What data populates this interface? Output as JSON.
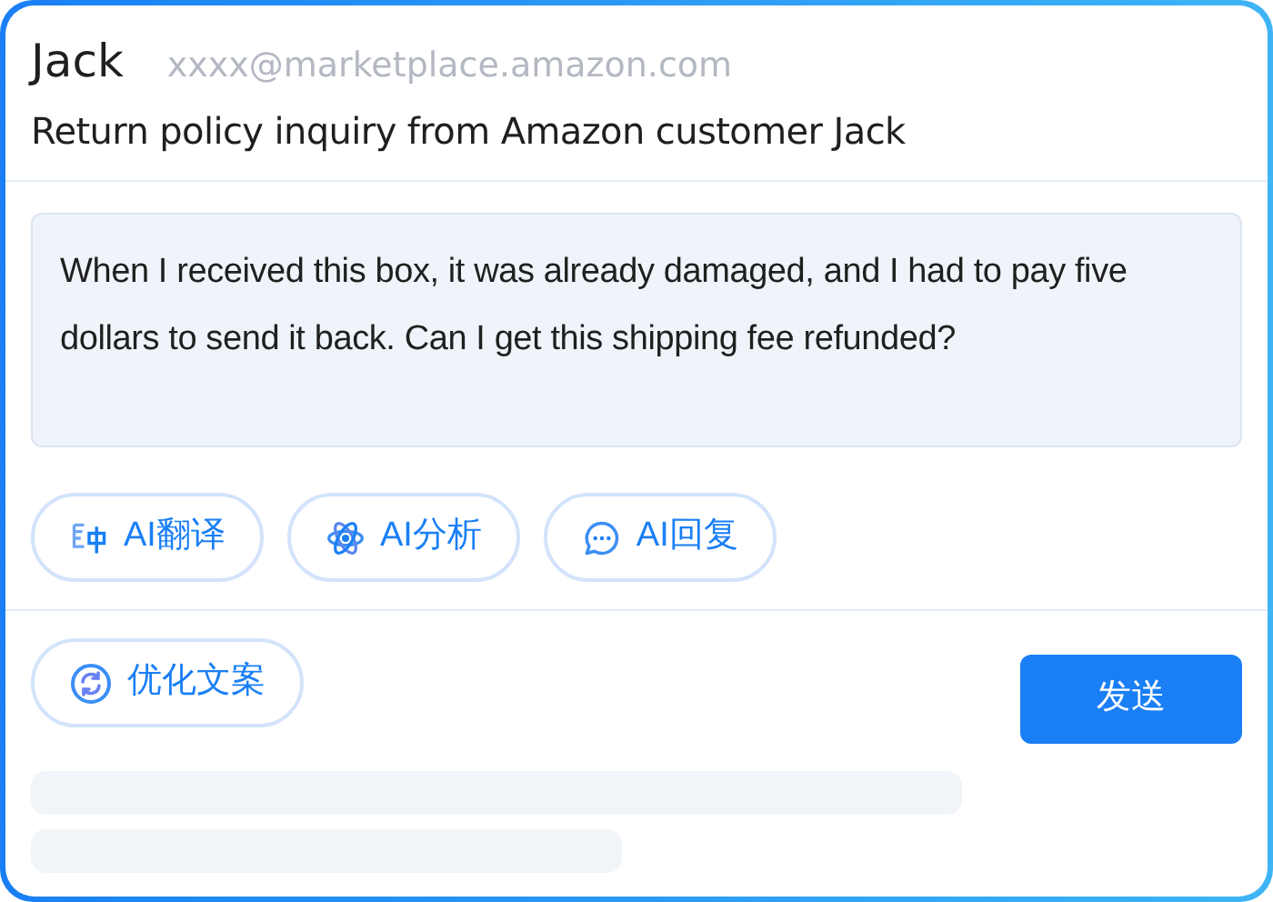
{
  "header": {
    "sender": "Jack",
    "email": "xxxx@marketplace.amazon.com",
    "subject": "Return policy inquiry from Amazon customer Jack"
  },
  "message": "When I received this box, it was already damaged, and I had to pay five dollars to send it back. Can I get this shipping fee refunded?",
  "ai_actions": [
    {
      "kind": "translate",
      "label": "AI翻译"
    },
    {
      "kind": "analyze",
      "label": "AI分析"
    },
    {
      "kind": "reply",
      "label": "AI回复"
    }
  ],
  "composer": {
    "optimize_button": "优化文案",
    "send_button": "发送"
  }
}
